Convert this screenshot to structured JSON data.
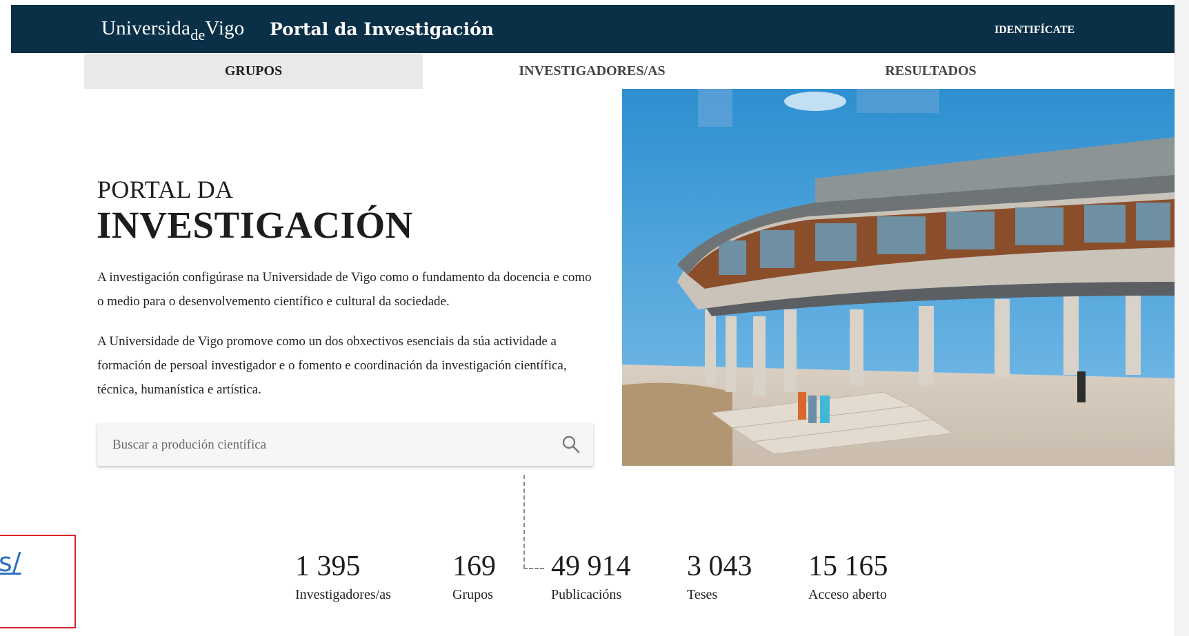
{
  "header": {
    "logo_left": "Universida",
    "logo_de": "de",
    "logo_right": "Vigo",
    "portal_title": "Portal da Investigación",
    "login_label": "IDENTIFÍCATE"
  },
  "tabs": [
    {
      "label": "GRUPOS",
      "active": true
    },
    {
      "label": "INVESTIGADORES/AS",
      "active": false
    },
    {
      "label": "RESULTADOS",
      "active": false
    }
  ],
  "hero": {
    "line1": "PORTAL DA",
    "line2": "INVESTIGACIÓN",
    "paragraph1": "A investigación configúrase na Universidade de Vigo como o fundamento da docencia e como o medio para o desenvolvemento científico e cultural da sociedade.",
    "paragraph2": "A Universidade de Vigo promove como un dos obxectivos esenciais da súa actividade a formación de persoal investigador e o fomento e coordinación da investigación científica, técnica, humanística e artística."
  },
  "search": {
    "placeholder": "Buscar a produción científica",
    "icon": "search-icon"
  },
  "stats": [
    {
      "value": "1 395",
      "label": "Investigadores/as"
    },
    {
      "value": "169",
      "label": "Grupos"
    },
    {
      "value": "49 914",
      "label": "Publicacións"
    },
    {
      "value": "3 043",
      "label": "Teses"
    },
    {
      "value": "15 165",
      "label": "Acceso aberto"
    }
  ],
  "overlay_link": {
    "text": "s/"
  },
  "colors": {
    "header_bg": "#0a3048",
    "active_tab_bg": "#e8e9ea",
    "highlight_border": "#d8252a",
    "link": "#2f6fc4"
  }
}
